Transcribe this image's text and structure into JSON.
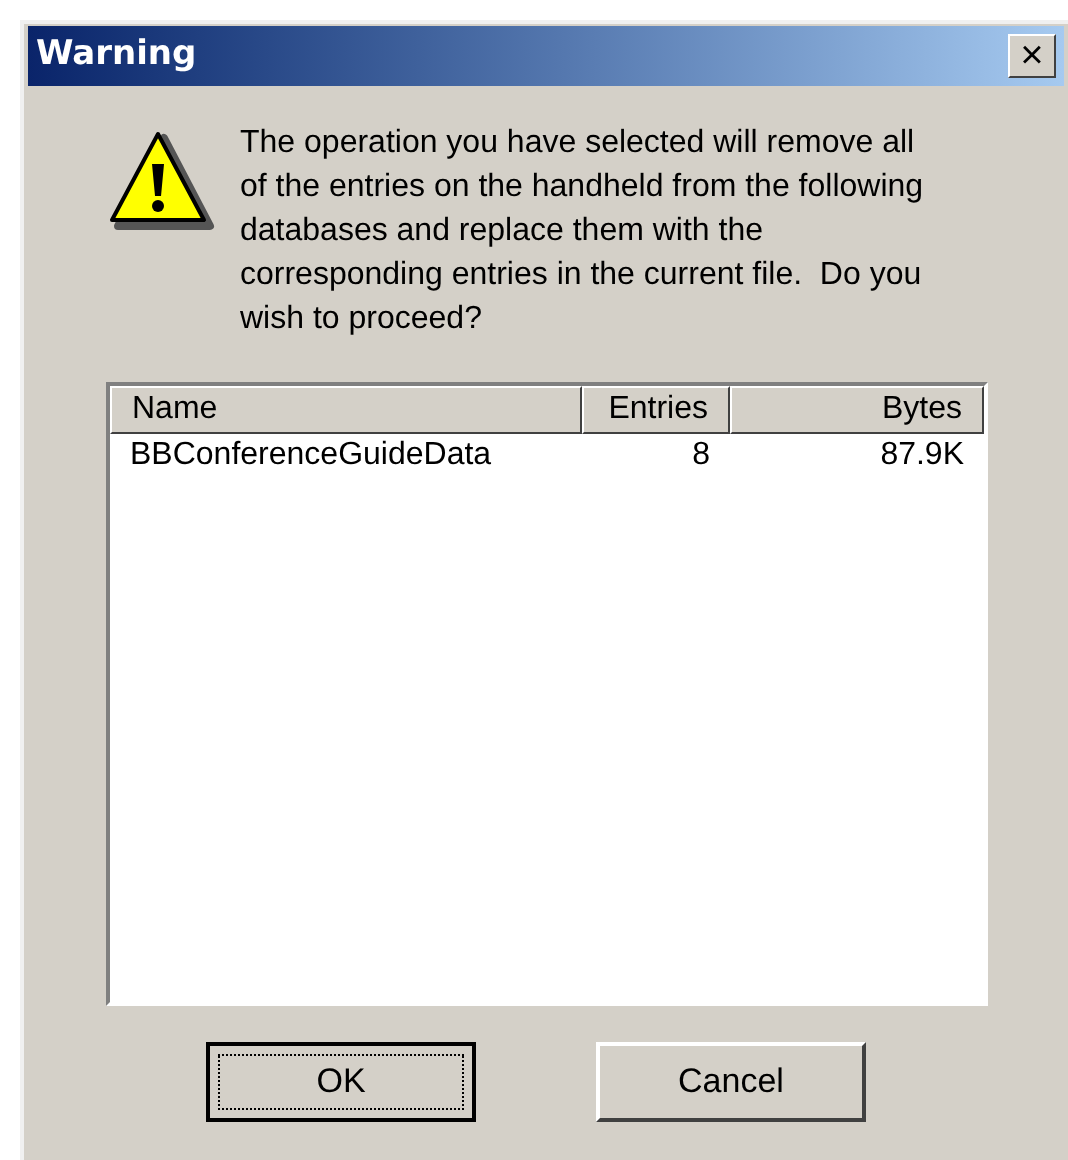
{
  "window": {
    "title": "Warning",
    "close": "×"
  },
  "message": "The operation you have selected will remove all of the entries on the handheld from the following databases and replace them with the corresponding entries in the current file.  Do you wish to proceed?",
  "table": {
    "columns": [
      {
        "label": "Name"
      },
      {
        "label": "Entries"
      },
      {
        "label": "Bytes"
      }
    ],
    "rows": [
      [
        "BBConferenceGuideData",
        "8",
        "87.9K"
      ]
    ]
  },
  "buttons": [
    {
      "label": "OK",
      "default": true
    },
    {
      "label": "Cancel",
      "default": false
    }
  ]
}
